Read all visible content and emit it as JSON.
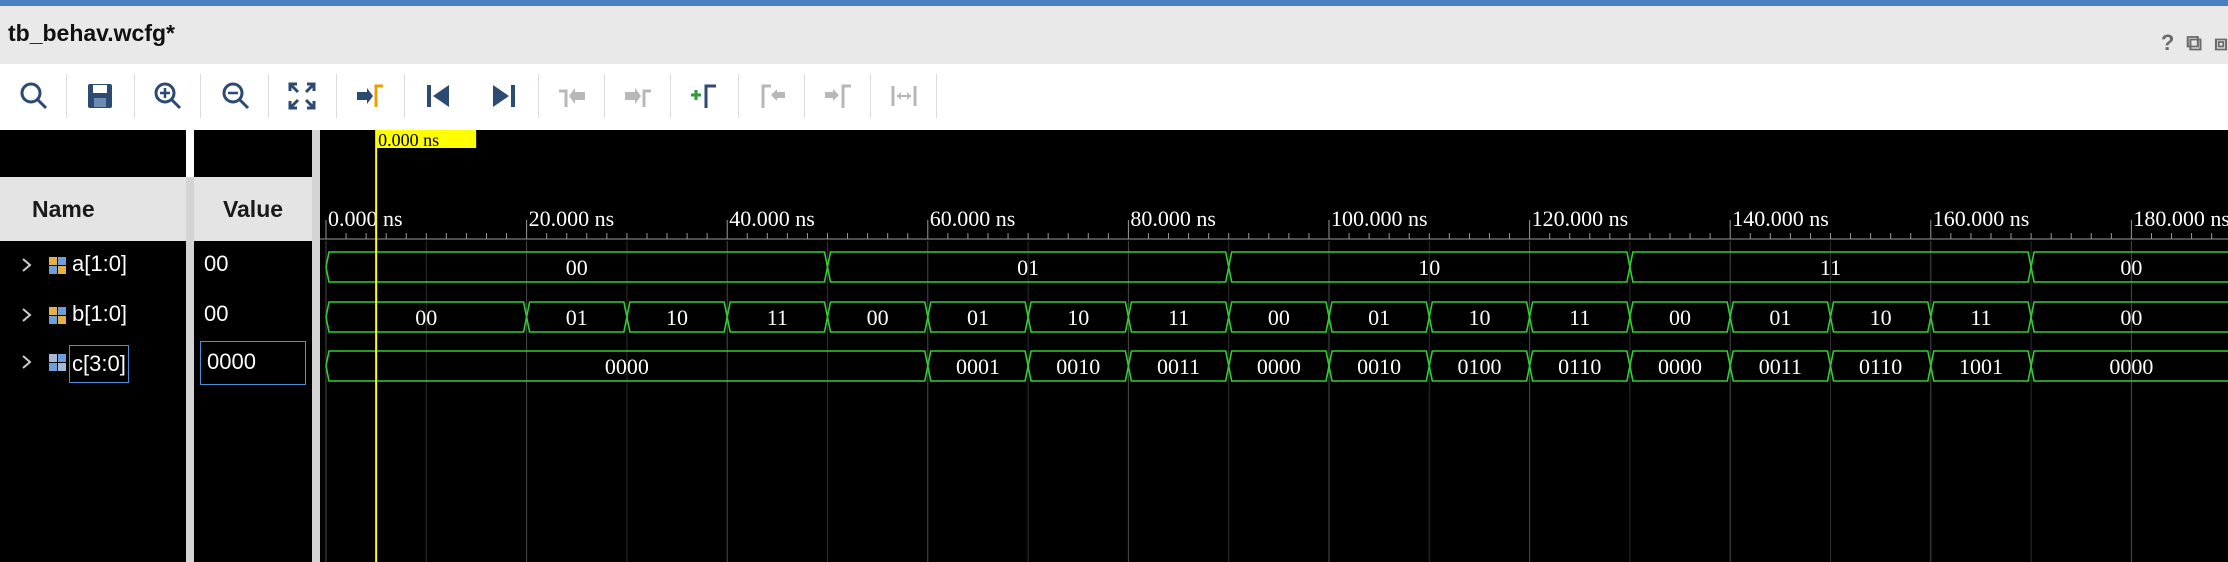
{
  "window": {
    "title": "tb_behav.wcfg*"
  },
  "controls": {
    "help": "?",
    "restore": "⧉",
    "maximize": "⧈"
  },
  "toolbar": {
    "buttons": [
      {
        "icon": "search-icon"
      },
      {
        "icon": "save-icon"
      },
      {
        "icon": "zoom-in-icon"
      },
      {
        "icon": "zoom-out-icon"
      },
      {
        "icon": "zoom-fit-icon"
      },
      {
        "icon": "go-to-cursor-icon"
      },
      {
        "icon": "go-to-time-0-icon"
      },
      {
        "icon": "go-to-last-time-icon"
      },
      {
        "icon": "previous-transition-icon"
      },
      {
        "icon": "next-transition-icon"
      },
      {
        "icon": "add-marker-icon"
      },
      {
        "icon": "previous-marker-icon"
      },
      {
        "icon": "next-marker-icon"
      },
      {
        "icon": "swap-cursors-icon"
      }
    ]
  },
  "headers": {
    "name": "Name",
    "value": "Value"
  },
  "cursor": {
    "label": "0.000 ns",
    "time_ns": 5
  },
  "timeline": {
    "ticks": [
      "0.000 ns",
      "20.000 ns",
      "40.000 ns",
      "60.000 ns",
      "80.000 ns",
      "100.000 ns",
      "120.000 ns",
      "140.000 ns",
      "160.000 ns",
      "180.000 ns"
    ],
    "tick_step_ns": 20
  },
  "signals": [
    {
      "name": "a[1:0]",
      "value": "00",
      "segments": [
        {
          "start": 0,
          "end": 50,
          "label": "00"
        },
        {
          "start": 50,
          "end": 90,
          "label": "01"
        },
        {
          "start": 90,
          "end": 130,
          "label": "10"
        },
        {
          "start": 130,
          "end": 170,
          "label": "11"
        },
        {
          "start": 170,
          "end": 190,
          "label": "00"
        }
      ]
    },
    {
      "name": "b[1:0]",
      "value": "00",
      "segments": [
        {
          "start": 0,
          "end": 20,
          "label": "00"
        },
        {
          "start": 20,
          "end": 30,
          "label": "01"
        },
        {
          "start": 30,
          "end": 40,
          "label": "10"
        },
        {
          "start": 40,
          "end": 50,
          "label": "11"
        },
        {
          "start": 50,
          "end": 60,
          "label": "00"
        },
        {
          "start": 60,
          "end": 70,
          "label": "01"
        },
        {
          "start": 70,
          "end": 80,
          "label": "10"
        },
        {
          "start": 80,
          "end": 90,
          "label": "11"
        },
        {
          "start": 90,
          "end": 100,
          "label": "00"
        },
        {
          "start": 100,
          "end": 110,
          "label": "01"
        },
        {
          "start": 110,
          "end": 120,
          "label": "10"
        },
        {
          "start": 120,
          "end": 130,
          "label": "11"
        },
        {
          "start": 130,
          "end": 140,
          "label": "00"
        },
        {
          "start": 140,
          "end": 150,
          "label": "01"
        },
        {
          "start": 150,
          "end": 160,
          "label": "10"
        },
        {
          "start": 160,
          "end": 170,
          "label": "11"
        },
        {
          "start": 170,
          "end": 190,
          "label": "00"
        }
      ]
    },
    {
      "name": "c[3:0]",
      "value": "0000",
      "segments": [
        {
          "start": 0,
          "end": 60,
          "label": "0000"
        },
        {
          "start": 60,
          "end": 70,
          "label": "0001"
        },
        {
          "start": 70,
          "end": 80,
          "label": "0010"
        },
        {
          "start": 80,
          "end": 90,
          "label": "0011"
        },
        {
          "start": 90,
          "end": 100,
          "label": "0000"
        },
        {
          "start": 100,
          "end": 110,
          "label": "0010"
        },
        {
          "start": 110,
          "end": 120,
          "label": "0100"
        },
        {
          "start": 120,
          "end": 130,
          "label": "0110"
        },
        {
          "start": 130,
          "end": 140,
          "label": "0000"
        },
        {
          "start": 140,
          "end": 150,
          "label": "0011"
        },
        {
          "start": 150,
          "end": 160,
          "label": "0110"
        },
        {
          "start": 160,
          "end": 170,
          "label": "1001"
        },
        {
          "start": 170,
          "end": 190,
          "label": "0000"
        }
      ]
    }
  ],
  "colors": {
    "wave": "#33cc33",
    "cursor": "#ffff00",
    "grid": "#4a4a4a",
    "background": "#000000"
  }
}
